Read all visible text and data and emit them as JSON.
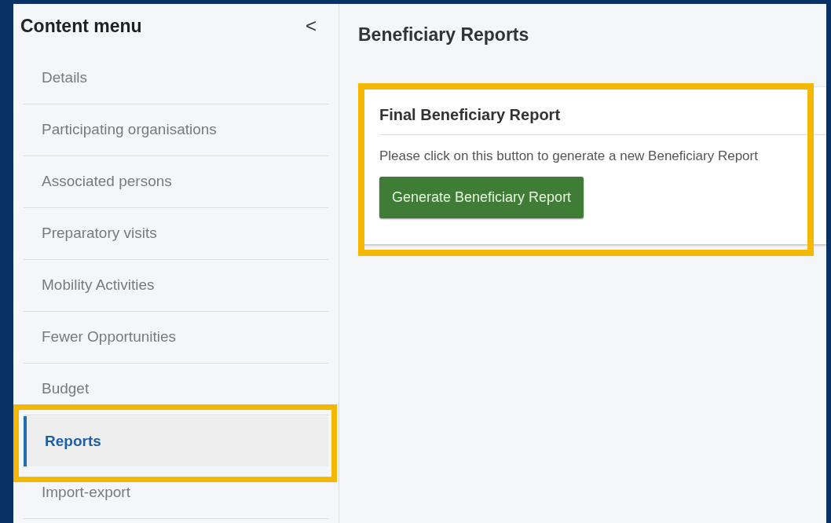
{
  "sidebar": {
    "title": "Content menu",
    "collapse_icon": "<",
    "items": [
      {
        "label": "Details",
        "selected": false,
        "highlighted": false
      },
      {
        "label": "Participating organisations",
        "selected": false,
        "highlighted": false
      },
      {
        "label": "Associated persons",
        "selected": false,
        "highlighted": false
      },
      {
        "label": "Preparatory visits",
        "selected": false,
        "highlighted": false
      },
      {
        "label": "Mobility Activities",
        "selected": false,
        "highlighted": false
      },
      {
        "label": "Fewer Opportunities",
        "selected": false,
        "highlighted": false
      },
      {
        "label": "Budget",
        "selected": false,
        "highlighted": false
      },
      {
        "label": "Reports",
        "selected": true,
        "highlighted": true
      },
      {
        "label": "Import-export",
        "selected": false,
        "highlighted": false
      }
    ]
  },
  "main": {
    "title": "Beneficiary Reports",
    "card": {
      "title": "Final Beneficiary Report",
      "text": "Please click on this button to generate a new Beneficiary Report",
      "button": "Generate Beneficiary Report",
      "highlighted": true
    }
  }
}
